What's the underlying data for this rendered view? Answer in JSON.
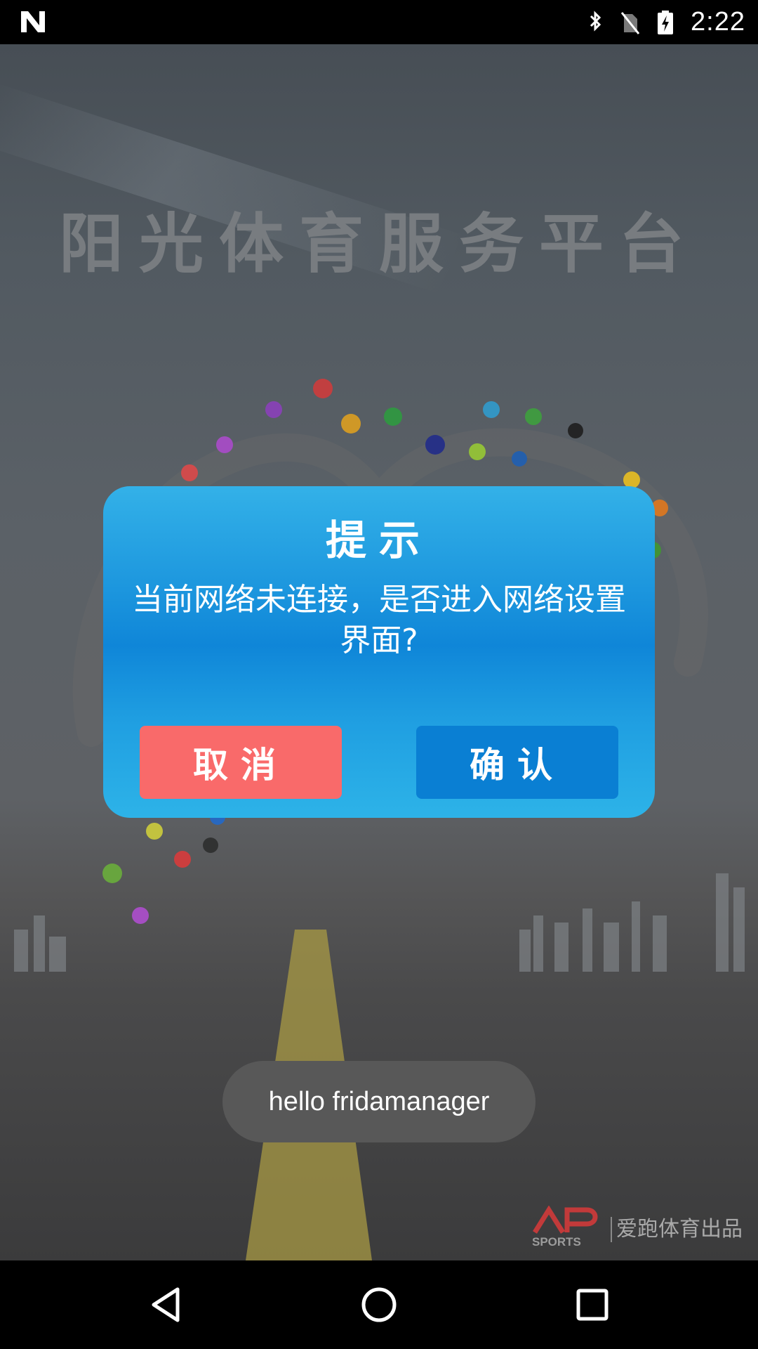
{
  "status_bar": {
    "notification_icon": "n-logo-icon",
    "icons": [
      "bluetooth-icon",
      "no-sim-icon",
      "battery-charging-icon"
    ],
    "time": "2:22"
  },
  "app": {
    "title": "阳光体育服务平台",
    "brand_logo_text": "AP SPORTS",
    "brand_text": "爱跑体育出品"
  },
  "dialog": {
    "title": "提示",
    "message": "当前网络未连接，是否进入网络设置界面?",
    "cancel_label": "取消",
    "confirm_label": "确认",
    "colors": {
      "dialog": "#1d97de",
      "cancel": "#f96a6a",
      "confirm": "#0a7fd3"
    }
  },
  "toast": {
    "text": "hello fridamanager"
  },
  "nav_bar": {
    "icons": [
      "back-icon",
      "home-icon",
      "recents-icon"
    ]
  }
}
